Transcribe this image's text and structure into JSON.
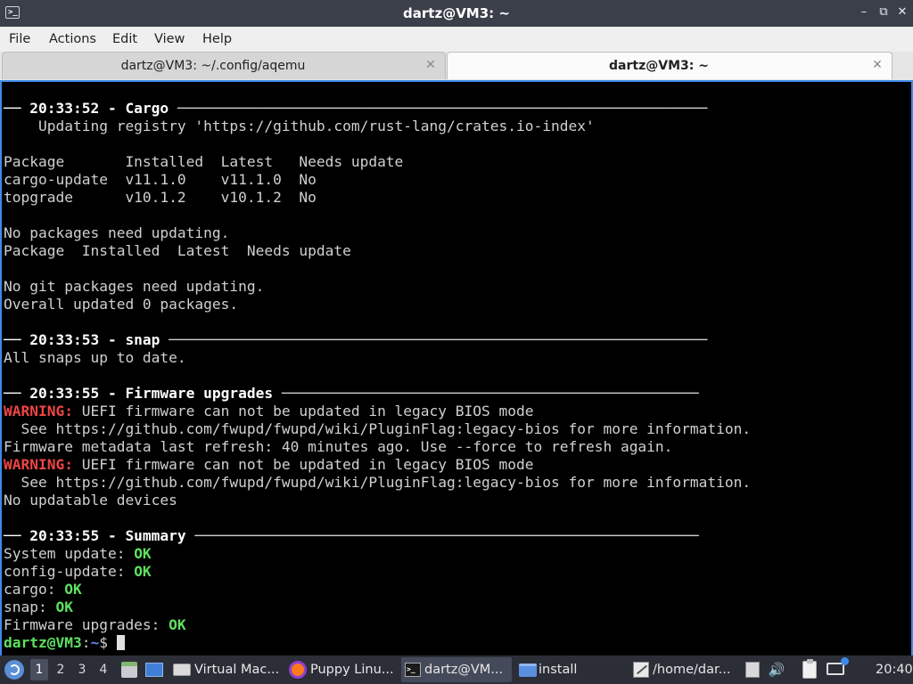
{
  "window": {
    "title": "dartz@VM3: ~",
    "app_icon": "terminal-icon",
    "buttons": [
      "minimize-icon",
      "restore-icon",
      "close-icon"
    ]
  },
  "menu": [
    "File",
    "Actions",
    "Edit",
    "View",
    "Help"
  ],
  "tabs": [
    {
      "label": "dartz@VM3: ~/.config/aqemu",
      "active": false
    },
    {
      "label": "dartz@VM3: ~",
      "active": true
    }
  ],
  "terminal": {
    "lines": [
      [
        {
          "t": "── 20:33:52 - Cargo ",
          "s": "bold"
        },
        {
          "t": "─────────────────────────────────────────────────────────────",
          "s": "normal"
        }
      ],
      [
        {
          "t": "    Updating registry 'https://github.com/rust-lang/crates.io-index'",
          "s": "normal"
        }
      ],
      [
        {
          "t": "",
          "s": "normal"
        }
      ],
      [
        {
          "t": "Package       Installed  Latest   Needs update",
          "s": "normal"
        }
      ],
      [
        {
          "t": "cargo-update  v11.1.0    v11.1.0  No",
          "s": "normal"
        }
      ],
      [
        {
          "t": "topgrade      v10.1.2    v10.1.2  No",
          "s": "normal"
        }
      ],
      [
        {
          "t": "",
          "s": "normal"
        }
      ],
      [
        {
          "t": "No packages need updating.",
          "s": "normal"
        }
      ],
      [
        {
          "t": "Package  Installed  Latest  Needs update",
          "s": "normal"
        }
      ],
      [
        {
          "t": "",
          "s": "normal"
        }
      ],
      [
        {
          "t": "No git packages need updating.",
          "s": "normal"
        }
      ],
      [
        {
          "t": "Overall updated 0 packages.",
          "s": "normal"
        }
      ],
      [
        {
          "t": "",
          "s": "normal"
        }
      ],
      [
        {
          "t": "── 20:33:53 - snap ",
          "s": "bold"
        },
        {
          "t": "──────────────────────────────────────────────────────────────",
          "s": "normal"
        }
      ],
      [
        {
          "t": "All snaps up to date.",
          "s": "normal"
        }
      ],
      [
        {
          "t": "",
          "s": "normal"
        }
      ],
      [
        {
          "t": "── 20:33:55 - Firmware upgrades ",
          "s": "bold"
        },
        {
          "t": "────────────────────────────────────────────────",
          "s": "normal"
        }
      ],
      [
        {
          "t": "WARNING:",
          "s": "warn"
        },
        {
          "t": " UEFI firmware can not be updated in legacy BIOS mode",
          "s": "normal"
        }
      ],
      [
        {
          "t": "  See https://github.com/fwupd/fwupd/wiki/PluginFlag:legacy-bios for more information.",
          "s": "normal"
        }
      ],
      [
        {
          "t": "Firmware metadata last refresh: 40 minutes ago. Use --force to refresh again.",
          "s": "normal"
        }
      ],
      [
        {
          "t": "WARNING:",
          "s": "warn"
        },
        {
          "t": " UEFI firmware can not be updated in legacy BIOS mode",
          "s": "normal"
        }
      ],
      [
        {
          "t": "  See https://github.com/fwupd/fwupd/wiki/PluginFlag:legacy-bios for more information.",
          "s": "normal"
        }
      ],
      [
        {
          "t": "No updatable devices",
          "s": "normal"
        }
      ],
      [
        {
          "t": "",
          "s": "normal"
        }
      ],
      [
        {
          "t": "── 20:33:55 - Summary ",
          "s": "bold"
        },
        {
          "t": "──────────────────────────────────────────────────────────",
          "s": "normal"
        }
      ],
      [
        {
          "t": "System update: ",
          "s": "normal"
        },
        {
          "t": "OK",
          "s": "ok"
        }
      ],
      [
        {
          "t": "config-update: ",
          "s": "normal"
        },
        {
          "t": "OK",
          "s": "ok"
        }
      ],
      [
        {
          "t": "cargo: ",
          "s": "normal"
        },
        {
          "t": "OK",
          "s": "ok"
        }
      ],
      [
        {
          "t": "snap: ",
          "s": "normal"
        },
        {
          "t": "OK",
          "s": "ok"
        }
      ],
      [
        {
          "t": "Firmware upgrades: ",
          "s": "normal"
        },
        {
          "t": "OK",
          "s": "ok"
        }
      ]
    ],
    "prompt": {
      "user_host": "dartz@VM3",
      "sep": ":",
      "path": "~",
      "symbol": "$ "
    }
  },
  "taskbar": {
    "menu_icon": "debian-menu-icon",
    "workspaces": [
      "1",
      "2",
      "3",
      "4"
    ],
    "active_workspace": "1",
    "launchers": [
      "file-manager-icon",
      "show-desktop-icon"
    ],
    "tasks": [
      {
        "label": "Virtual Mac...",
        "icon": "virtual-machine-icon"
      },
      {
        "label": "Puppy Linu...",
        "icon": "firefox-icon"
      },
      {
        "label": "dartz@VM...",
        "icon": "terminal-icon",
        "active": true
      },
      {
        "label": "install",
        "icon": "folder-icon"
      },
      {
        "label": "/home/dar...",
        "icon": "text-editor-icon"
      }
    ],
    "tray": [
      "keyboard-layout-icon",
      "volume-icon",
      "clipboard-icon",
      "network-icon"
    ],
    "clock": "20:40"
  },
  "colors": {
    "ok": "#5ee05e",
    "warning": "#ef4545",
    "prompt_user": "#5ee05e",
    "prompt_path": "#5d8cf0",
    "terminal_border": "#3d8be8"
  }
}
